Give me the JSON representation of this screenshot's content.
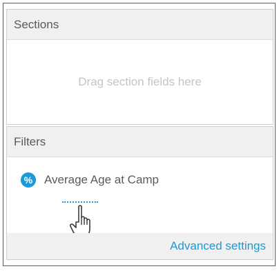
{
  "sections": {
    "title": "Sections",
    "placeholder": "Drag section fields here"
  },
  "filters": {
    "title": "Filters",
    "items": [
      {
        "icon": "percent-icon",
        "icon_glyph": "%",
        "label": "Average Age at Camp"
      }
    ],
    "advanced_settings_label": "Advanced settings"
  },
  "colors": {
    "accent": "#1a9ad6",
    "header_bg": "#f0f0f0",
    "placeholder_text": "#c4c4c4"
  }
}
